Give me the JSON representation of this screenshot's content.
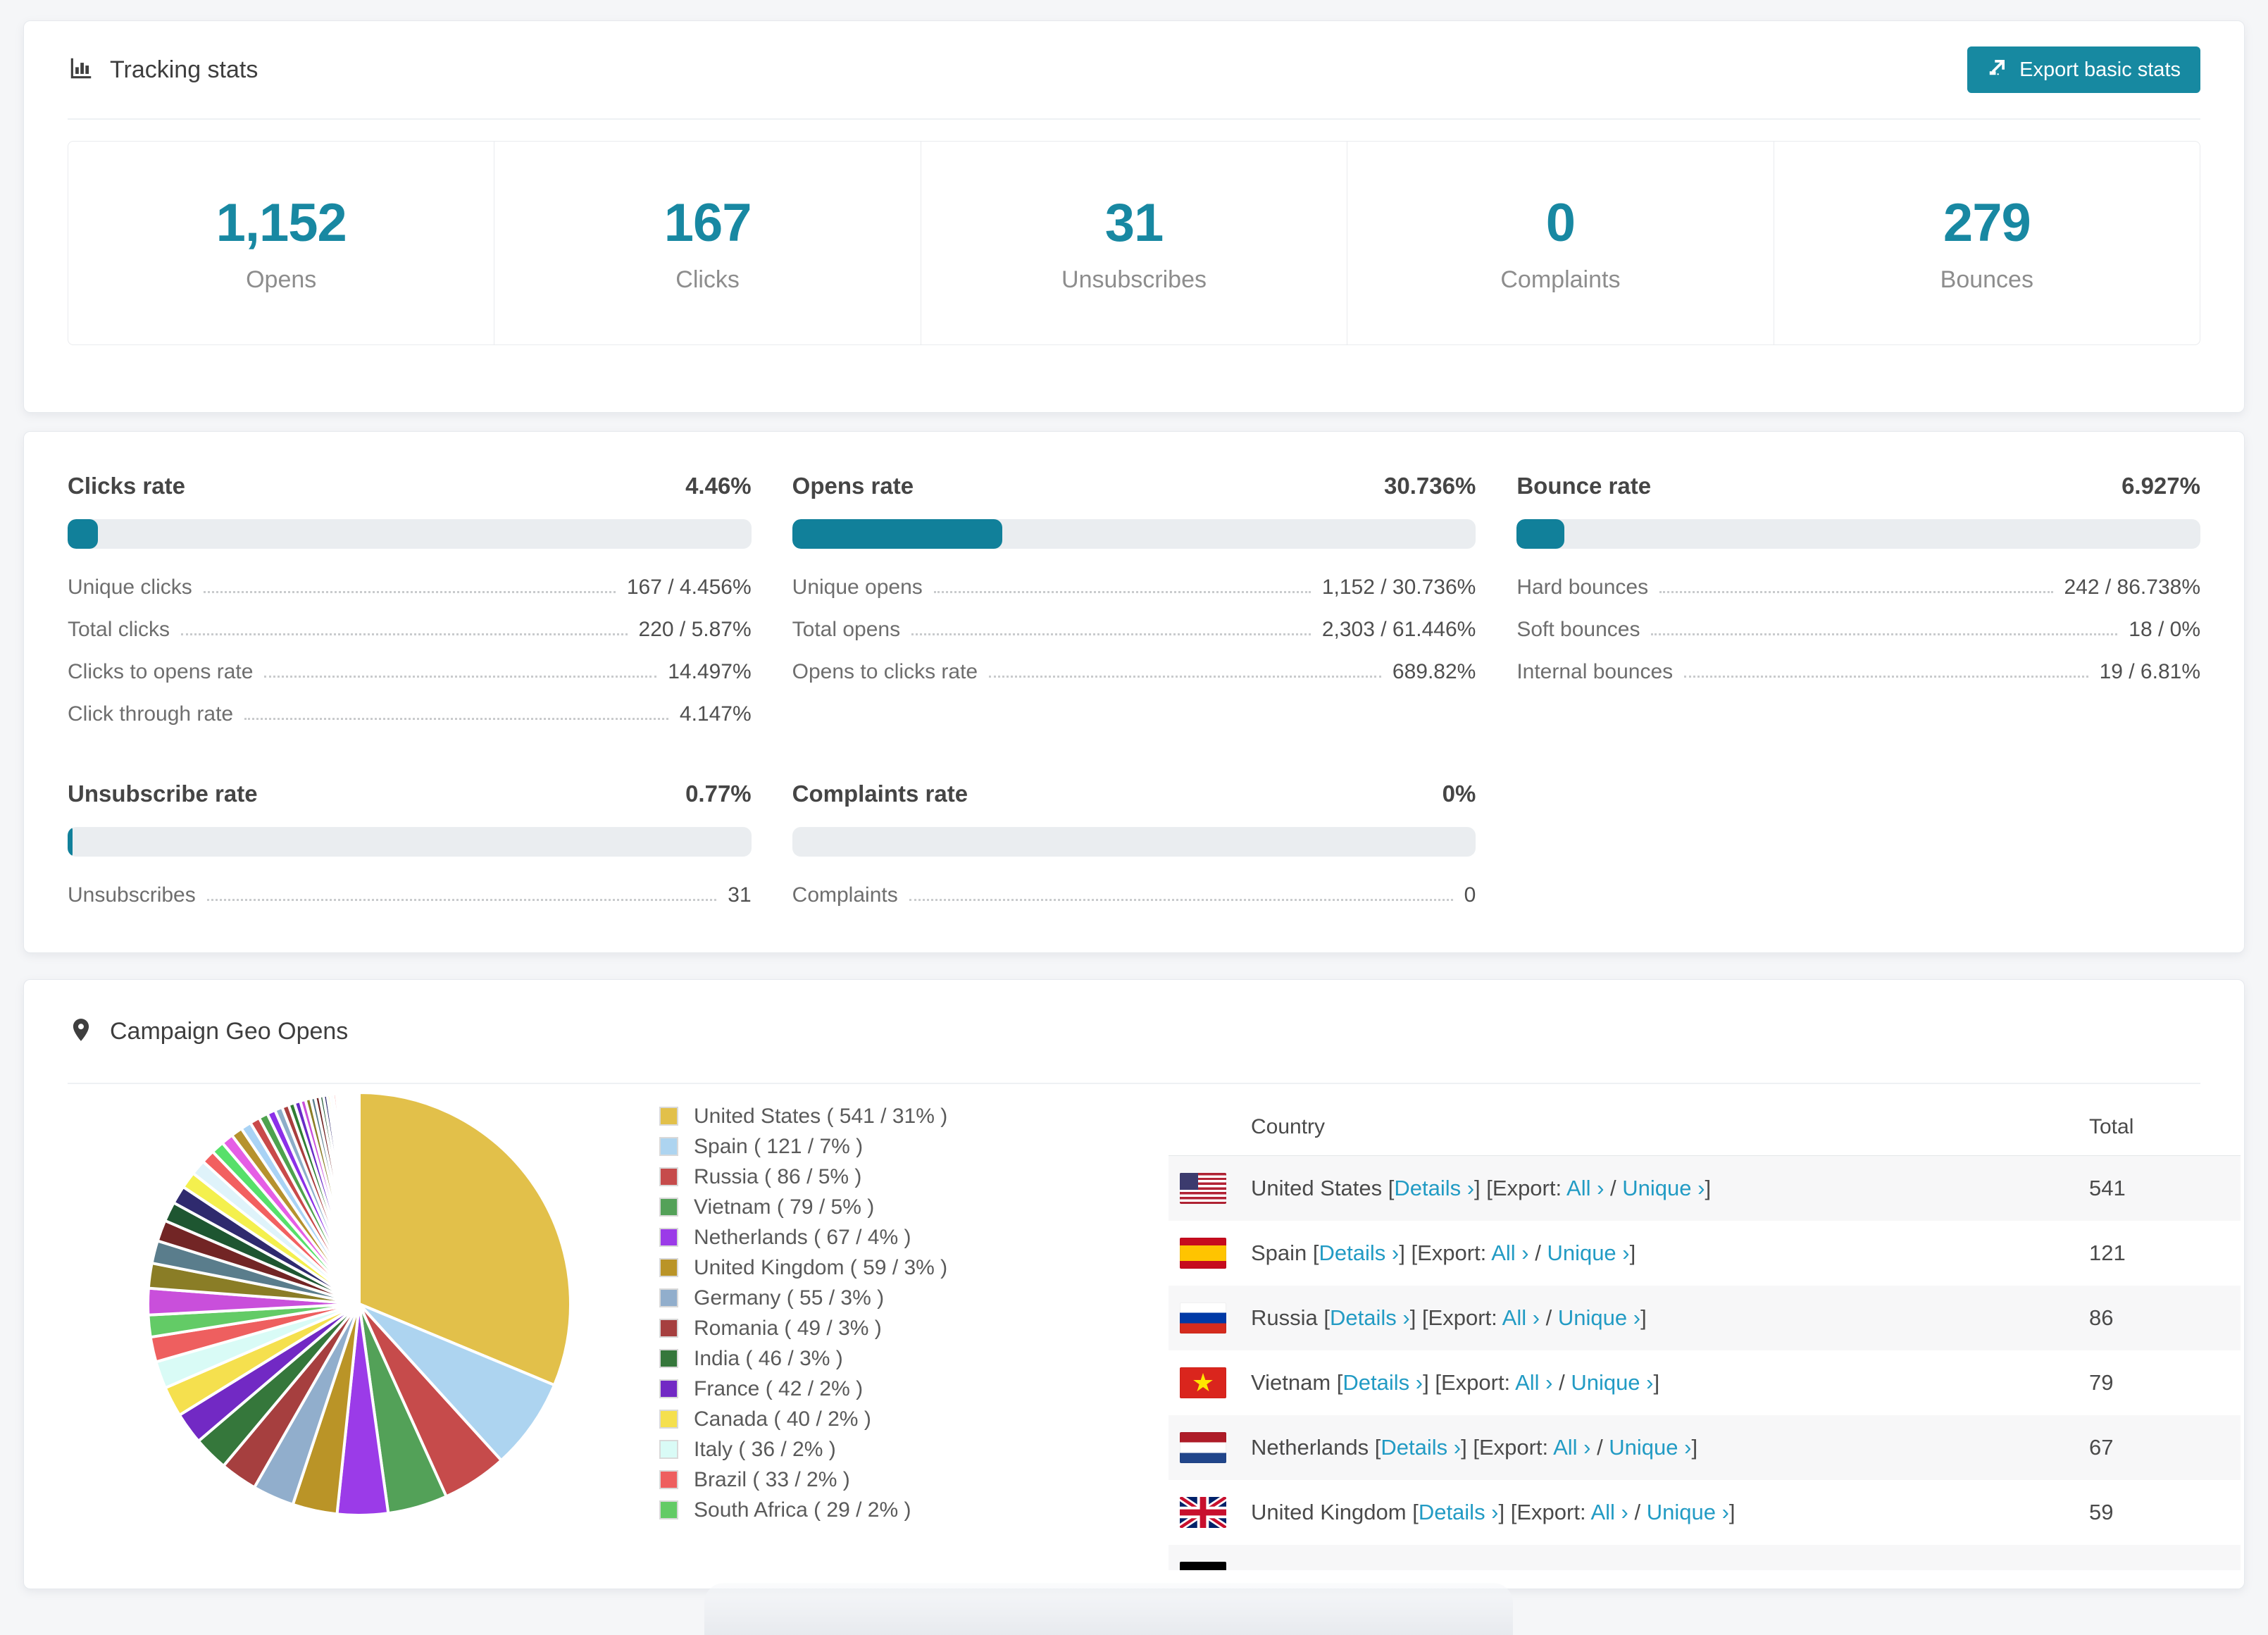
{
  "accent": {
    "teal": "#1789A1",
    "bar_fill": "#11809A",
    "link": "#229BC4"
  },
  "tracking": {
    "title": "Tracking stats",
    "export_button": "Export basic stats",
    "summary": [
      {
        "value": "1,152",
        "label": "Opens"
      },
      {
        "value": "167",
        "label": "Clicks"
      },
      {
        "value": "31",
        "label": "Unsubscribes"
      },
      {
        "value": "0",
        "label": "Complaints"
      },
      {
        "value": "279",
        "label": "Bounces"
      }
    ]
  },
  "rates": {
    "panels": [
      {
        "title": "Clicks rate",
        "value": "4.46%",
        "percent": 4.46,
        "rows": [
          {
            "label": "Unique clicks",
            "value": "167 / 4.456%"
          },
          {
            "label": "Total clicks",
            "value": "220 / 5.87%"
          },
          {
            "label": "Clicks to opens rate",
            "value": "14.497%"
          },
          {
            "label": "Click through rate",
            "value": "4.147%"
          }
        ]
      },
      {
        "title": "Opens rate",
        "value": "30.736%",
        "percent": 30.736,
        "rows": [
          {
            "label": "Unique opens",
            "value": "1,152 / 30.736%"
          },
          {
            "label": "Total opens",
            "value": "2,303 / 61.446%"
          },
          {
            "label": "Opens to clicks rate",
            "value": "689.82%"
          }
        ]
      },
      {
        "title": "Bounce rate",
        "value": "6.927%",
        "percent": 6.927,
        "rows": [
          {
            "label": "Hard bounces",
            "value": "242 / 86.738%"
          },
          {
            "label": "Soft bounces",
            "value": "18 / 0%"
          },
          {
            "label": "Internal bounces",
            "value": "19 / 6.81%"
          }
        ]
      },
      {
        "title": "Unsubscribe rate",
        "value": "0.77%",
        "percent": 0.77,
        "rows": [
          {
            "label": "Unsubscribes",
            "value": "31"
          }
        ]
      },
      {
        "title": "Complaints rate",
        "value": "0%",
        "percent": 0,
        "rows": [
          {
            "label": "Complaints",
            "value": "0"
          }
        ]
      }
    ]
  },
  "geo": {
    "title": "Campaign Geo Opens",
    "columns": {
      "country": "Country",
      "total": "Total"
    },
    "link_labels": {
      "bracket_open": " [",
      "bracket_close": "] ",
      "details": "Details ›",
      "export_prefix": " [Export: ",
      "all": "All ›",
      "slash": " / ",
      "unique": "Unique ›",
      "close": "]"
    },
    "rows": [
      {
        "country": "United States",
        "flag": "us",
        "total": "541",
        "partial": false
      },
      {
        "country": "Spain",
        "flag": "es",
        "total": "121",
        "partial": false
      },
      {
        "country": "Russia",
        "flag": "ru",
        "total": "86",
        "partial": false
      },
      {
        "country": "Vietnam",
        "flag": "vn",
        "total": "79",
        "partial": false
      },
      {
        "country": "Netherlands",
        "flag": "nl",
        "total": "67",
        "partial": false
      },
      {
        "country": "United Kingdom",
        "flag": "gb",
        "total": "59",
        "partial": false
      },
      {
        "country": "",
        "flag": "de",
        "total": "",
        "partial": true
      }
    ]
  },
  "chart_data": {
    "type": "pie",
    "title": "Campaign Geo Opens",
    "legend_position": "right",
    "start_angle": -90,
    "series": [
      {
        "name": "United States",
        "value": 541,
        "pct": "31%",
        "color": "#E2C04A"
      },
      {
        "name": "Spain",
        "value": 121,
        "pct": "7%",
        "color": "#ADD4F0"
      },
      {
        "name": "Russia",
        "value": 86,
        "pct": "5%",
        "color": "#C64B4B"
      },
      {
        "name": "Vietnam",
        "value": 79,
        "pct": "5%",
        "color": "#53A158"
      },
      {
        "name": "Netherlands",
        "value": 67,
        "pct": "4%",
        "color": "#9B3BE8"
      },
      {
        "name": "United Kingdom",
        "value": 59,
        "pct": "3%",
        "color": "#BA9427"
      },
      {
        "name": "Germany",
        "value": 55,
        "pct": "3%",
        "color": "#91AECC"
      },
      {
        "name": "Romania",
        "value": 49,
        "pct": "3%",
        "color": "#A63F3F"
      },
      {
        "name": "India",
        "value": 46,
        "pct": "3%",
        "color": "#35773B"
      },
      {
        "name": "France",
        "value": 42,
        "pct": "2%",
        "color": "#7229C4"
      },
      {
        "name": "Canada",
        "value": 40,
        "pct": "2%",
        "color": "#F5E04E"
      },
      {
        "name": "Italy",
        "value": 36,
        "pct": "2%",
        "color": "#D9FBF6"
      },
      {
        "name": "Brazil",
        "value": 33,
        "pct": "2%",
        "color": "#EE5F5F"
      },
      {
        "name": "South Africa",
        "value": 29,
        "pct": "2%",
        "color": "#63CB66"
      }
    ],
    "others": {
      "values": [
        35,
        33,
        30,
        28,
        26,
        24,
        22,
        20,
        18,
        17,
        16,
        15,
        14,
        13,
        12,
        11,
        10,
        9,
        8,
        8,
        7,
        7,
        6,
        6,
        5,
        5,
        4,
        4,
        4,
        3,
        3,
        3,
        3,
        2,
        2,
        2,
        2,
        2,
        1,
        1,
        1,
        1,
        1,
        1,
        1,
        1
      ],
      "palette": [
        "#C94FDB",
        "#8A7D26",
        "#5A7D8C",
        "#722525",
        "#1E5631",
        "#2F2A6E",
        "#F4F04E",
        "#DFF3FA",
        "#F26060",
        "#57E06A",
        "#E55EE5",
        "#B6922E",
        "#A9D3F5",
        "#C94A4A",
        "#4EA24E",
        "#8B30E8",
        "#8CAEC9",
        "#A93E3E",
        "#2F7D33",
        "#6A2BC7"
      ]
    }
  }
}
